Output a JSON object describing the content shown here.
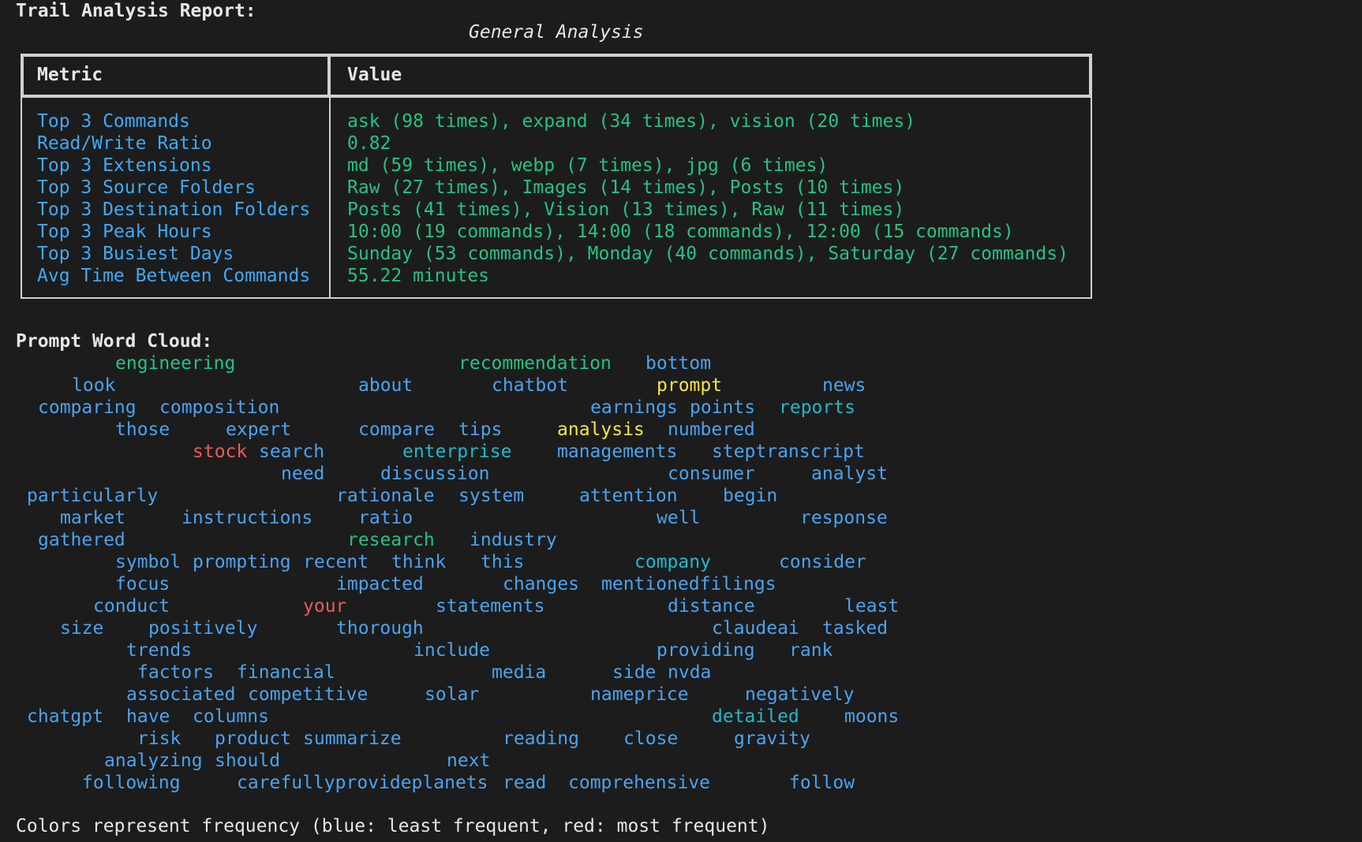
{
  "report": {
    "title": "Trail Analysis Report:",
    "table_caption": "General Analysis",
    "columns": [
      "Metric",
      "Value"
    ],
    "rows": [
      {
        "metric": "Top 3 Commands",
        "value": "ask (98 times), expand (34 times), vision (20 times)"
      },
      {
        "metric": "Read/Write Ratio",
        "value": "0.82"
      },
      {
        "metric": "Top 3 Extensions",
        "value": "md (59 times), webp (7 times), jpg (6 times)"
      },
      {
        "metric": "Top 3 Source Folders",
        "value": "Raw (27 times), Images (14 times), Posts (10 times)"
      },
      {
        "metric": "Top 3 Destination Folders",
        "value": "Posts (41 times), Vision (13 times), Raw (11 times)"
      },
      {
        "metric": "Top 3 Peak Hours",
        "value": "10:00 (19 commands), 14:00 (18 commands), 12:00 (15 commands)"
      },
      {
        "metric": "Top 3 Busiest Days",
        "value": "Sunday (53 commands), Monday (40 commands), Saturday (27 commands)"
      },
      {
        "metric": "Avg Time Between Commands",
        "value": "55.22 minutes"
      }
    ]
  },
  "cloud": {
    "title": "Prompt Word Cloud:",
    "colors": {
      "blue": "#4aa3f0",
      "cyan": "#22b8c8",
      "green": "#26c281",
      "yellow": "#f5e642",
      "red": "#e85c5c"
    },
    "words": [
      {
        "text": "engineering",
        "color": "green"
      },
      {
        "text": "recommendation",
        "color": "green"
      },
      {
        "text": "bottom",
        "color": "blue"
      },
      {
        "text": "look",
        "color": "blue"
      },
      {
        "text": "about",
        "color": "blue"
      },
      {
        "text": "chatbot",
        "color": "blue"
      },
      {
        "text": "prompt",
        "color": "yellow"
      },
      {
        "text": "news",
        "color": "blue"
      },
      {
        "text": "comparing",
        "color": "blue"
      },
      {
        "text": "composition",
        "color": "blue"
      },
      {
        "text": "earnings",
        "color": "blue"
      },
      {
        "text": "points",
        "color": "blue"
      },
      {
        "text": "reports",
        "color": "cyan"
      },
      {
        "text": "those",
        "color": "blue"
      },
      {
        "text": "expert",
        "color": "blue"
      },
      {
        "text": "compare",
        "color": "blue"
      },
      {
        "text": "tips",
        "color": "blue"
      },
      {
        "text": "analysis",
        "color": "yellow"
      },
      {
        "text": "numbered",
        "color": "blue"
      },
      {
        "text": "stock",
        "color": "red"
      },
      {
        "text": "search",
        "color": "blue"
      },
      {
        "text": "enterprise",
        "color": "cyan"
      },
      {
        "text": "managements",
        "color": "blue"
      },
      {
        "text": "steptranscript",
        "color": "blue"
      },
      {
        "text": "need",
        "color": "blue"
      },
      {
        "text": "discussion",
        "color": "blue"
      },
      {
        "text": "consumer",
        "color": "blue"
      },
      {
        "text": "analyst",
        "color": "blue"
      },
      {
        "text": "particularly",
        "color": "blue"
      },
      {
        "text": "rationale",
        "color": "blue"
      },
      {
        "text": "system",
        "color": "blue"
      },
      {
        "text": "attention",
        "color": "blue"
      },
      {
        "text": "begin",
        "color": "blue"
      },
      {
        "text": "market",
        "color": "blue"
      },
      {
        "text": "instructions",
        "color": "blue"
      },
      {
        "text": "ratio",
        "color": "blue"
      },
      {
        "text": "well",
        "color": "blue"
      },
      {
        "text": "response",
        "color": "blue"
      },
      {
        "text": "gathered",
        "color": "blue"
      },
      {
        "text": "research",
        "color": "green"
      },
      {
        "text": "industry",
        "color": "blue"
      },
      {
        "text": "symbol",
        "color": "blue"
      },
      {
        "text": "prompting",
        "color": "blue"
      },
      {
        "text": "recent",
        "color": "blue"
      },
      {
        "text": "think",
        "color": "blue"
      },
      {
        "text": "this",
        "color": "blue"
      },
      {
        "text": "company",
        "color": "cyan"
      },
      {
        "text": "consider",
        "color": "blue"
      },
      {
        "text": "focus",
        "color": "blue"
      },
      {
        "text": "impacted",
        "color": "blue"
      },
      {
        "text": "changes",
        "color": "blue"
      },
      {
        "text": "mentionedfilings",
        "color": "blue"
      },
      {
        "text": "conduct",
        "color": "blue"
      },
      {
        "text": "your",
        "color": "red"
      },
      {
        "text": "statements",
        "color": "blue"
      },
      {
        "text": "distance",
        "color": "blue"
      },
      {
        "text": "least",
        "color": "blue"
      },
      {
        "text": "size",
        "color": "blue"
      },
      {
        "text": "positively",
        "color": "blue"
      },
      {
        "text": "thorough",
        "color": "blue"
      },
      {
        "text": "claudeai",
        "color": "blue"
      },
      {
        "text": "tasked",
        "color": "blue"
      },
      {
        "text": "trends",
        "color": "blue"
      },
      {
        "text": "include",
        "color": "blue"
      },
      {
        "text": "providing",
        "color": "blue"
      },
      {
        "text": "rank",
        "color": "blue"
      },
      {
        "text": "factors",
        "color": "blue"
      },
      {
        "text": "financial",
        "color": "blue"
      },
      {
        "text": "media",
        "color": "blue"
      },
      {
        "text": "side",
        "color": "blue"
      },
      {
        "text": "nvda",
        "color": "blue"
      },
      {
        "text": "associated",
        "color": "blue"
      },
      {
        "text": "competitive",
        "color": "blue"
      },
      {
        "text": "solar",
        "color": "blue"
      },
      {
        "text": "nameprice",
        "color": "blue"
      },
      {
        "text": "negatively",
        "color": "blue"
      },
      {
        "text": "chatgpt",
        "color": "blue"
      },
      {
        "text": "have",
        "color": "blue"
      },
      {
        "text": "columns",
        "color": "blue"
      },
      {
        "text": "detailed",
        "color": "cyan"
      },
      {
        "text": "moons",
        "color": "blue"
      },
      {
        "text": "risk",
        "color": "blue"
      },
      {
        "text": "product",
        "color": "blue"
      },
      {
        "text": "summarize",
        "color": "blue"
      },
      {
        "text": "reading",
        "color": "blue"
      },
      {
        "text": "close",
        "color": "blue"
      },
      {
        "text": "gravity",
        "color": "blue"
      },
      {
        "text": "analyzing",
        "color": "blue"
      },
      {
        "text": "should",
        "color": "blue"
      },
      {
        "text": "next",
        "color": "blue"
      },
      {
        "text": "following",
        "color": "blue"
      },
      {
        "text": "carefullyprovideplanets",
        "color": "blue"
      },
      {
        "text": "read",
        "color": "blue"
      },
      {
        "text": "comprehensive",
        "color": "blue"
      },
      {
        "text": "follow",
        "color": "blue"
      }
    ],
    "legend": "Colors represent frequency (blue: least frequent, red: most frequent)"
  }
}
